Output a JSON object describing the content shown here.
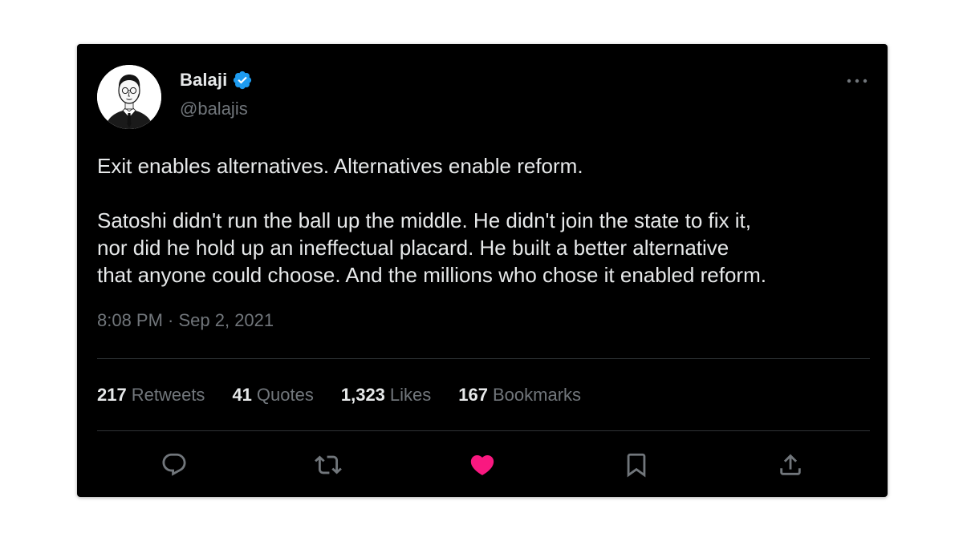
{
  "tweet": {
    "author": {
      "name": "Balaji",
      "handle": "@balajis",
      "verified": true,
      "verified_color": "#1d9bf0"
    },
    "text": {
      "paragraph1": "Exit enables alternatives. Alternatives enable reform.",
      "paragraph2_lines": [
        "Satoshi didn't run the ball up the middle. He didn't join the state to fix it,",
        "nor did he hold up an ineffectual placard. He built a better alternative",
        "that anyone could choose. And the millions who chose it enabled reform."
      ]
    },
    "timestamp": "8:08 PM · Sep 2, 2021",
    "stats": {
      "retweets": {
        "count": "217",
        "label": "Retweets"
      },
      "quotes": {
        "count": "41",
        "label": "Quotes"
      },
      "likes": {
        "count": "1,323",
        "label": "Likes"
      },
      "bookmarks": {
        "count": "167",
        "label": "Bookmarks"
      }
    },
    "actions": {
      "reply_icon": "reply-icon",
      "retweet_icon": "retweet-icon",
      "like_icon": "heart-icon",
      "like_active": true,
      "like_color": "#f91880",
      "bookmark_icon": "bookmark-icon",
      "share_icon": "share-icon"
    },
    "more_icon": "more-horizontal-icon"
  },
  "theme": {
    "background": "#000000",
    "text_primary": "#e7e9ea",
    "text_secondary": "#71767b",
    "divider": "#2f3336"
  }
}
